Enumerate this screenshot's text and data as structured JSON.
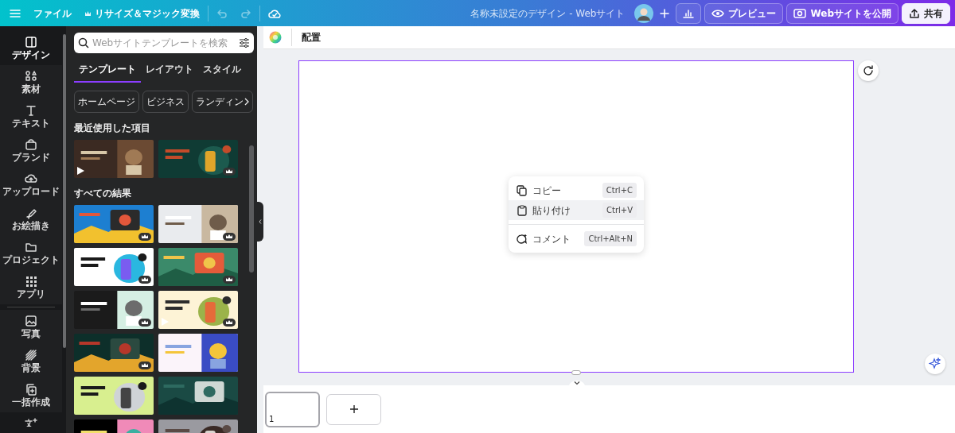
{
  "topbar": {
    "menu_items": [
      {
        "label": "ファイル",
        "icon": false
      },
      {
        "label": "リサイズ＆マジック変換",
        "icon": true
      }
    ],
    "undo_disabled": true,
    "redo_disabled": true,
    "title": "名称未設定のデザイン - Webサイト",
    "buttons": [
      {
        "kind": "preview",
        "label": "プレビュー"
      },
      {
        "kind": "publish",
        "label": "Webサイトを公開"
      },
      {
        "kind": "share",
        "label": "共有"
      }
    ]
  },
  "rail": [
    {
      "label": "デザイン",
      "selected": true
    },
    {
      "label": "素材",
      "selected": false
    },
    {
      "label": "テキスト",
      "selected": false
    },
    {
      "label": "ブランド",
      "selected": false
    },
    {
      "label": "アップロード",
      "selected": false
    },
    {
      "label": "お絵描き",
      "selected": false
    },
    {
      "label": "プロジェクト",
      "selected": false
    },
    {
      "label": "アプリ",
      "selected": false
    },
    {
      "label": "写真",
      "selected": false
    },
    {
      "label": "背景",
      "selected": false
    },
    {
      "label": "一括作成",
      "selected": false
    }
  ],
  "panel": {
    "search": {
      "placeholder": "Webサイトテンプレートを検索"
    },
    "tabs": [
      {
        "label": "テンプレート",
        "selected": true
      },
      {
        "label": "レイアウト",
        "selected": false
      },
      {
        "label": "スタイル",
        "selected": false
      }
    ],
    "chips": [
      "ホームページ",
      "ビジネス",
      "ランディン"
    ],
    "sections": [
      {
        "title": "最近使用した項目",
        "items": [
          {
            "kind": "picture",
            "video": true,
            "premium": false
          },
          {
            "kind": "picture",
            "video": false,
            "premium": true
          }
        ]
      },
      {
        "title": "すべての結果",
        "items": [
          {
            "kind": "picture",
            "video": false,
            "premium": true
          },
          {
            "kind": "picture",
            "video": false,
            "premium": true
          },
          {
            "kind": "picture",
            "video": false,
            "premium": true
          },
          {
            "kind": "picture",
            "video": false,
            "premium": true
          },
          {
            "kind": "picture",
            "video": false,
            "premium": true
          },
          {
            "kind": "picture",
            "video": true,
            "premium": true
          },
          {
            "kind": "picture",
            "video": false,
            "premium": true
          },
          {
            "kind": "picture",
            "video": false,
            "premium": false
          },
          {
            "kind": "picture",
            "video": false,
            "premium": false
          },
          {
            "kind": "picture",
            "video": false,
            "premium": false
          },
          {
            "kind": "picture",
            "video": false,
            "premium": false
          },
          {
            "kind": "picture",
            "video": false,
            "premium": false
          }
        ]
      }
    ]
  },
  "toolbar": {
    "label": "配置"
  },
  "context_menu": [
    {
      "kind": "item",
      "label": "コピー",
      "shortcut": "Ctrl+C",
      "selected": false
    },
    {
      "kind": "item",
      "label": "貼り付け",
      "shortcut": "Ctrl+V",
      "selected": true
    },
    {
      "kind": "divider"
    },
    {
      "kind": "item",
      "label": "コメント",
      "shortcut": "Ctrl+Alt+N",
      "selected": false
    }
  ],
  "pages": [
    {
      "number": "1",
      "selected": true
    }
  ]
}
